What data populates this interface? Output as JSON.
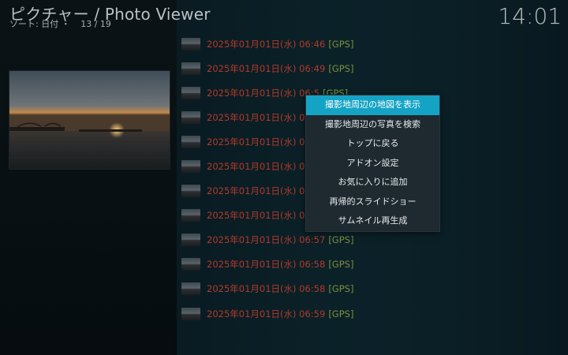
{
  "header": {
    "title": "ピクチャー / Photo Viewer",
    "sort_label": "ソート: 日付 ・",
    "count": "13 / 19"
  },
  "clock": "14:01",
  "list": {
    "items": [
      {
        "date": "2025年01月01日(水) 06:46",
        "gps": "[GPS]"
      },
      {
        "date": "2025年01月01日(水) 06:49",
        "gps": "[GPS]"
      },
      {
        "date": "2025年01月01日(水) 06:5",
        "gps": "[GPS]"
      },
      {
        "date": "2025年01月01日(水) 06:5",
        "gps": ""
      },
      {
        "date": "2025年01月01日(水) 06:5",
        "gps": ""
      },
      {
        "date": "2025年01月01日(水) 06:5",
        "gps": ""
      },
      {
        "date": "2025年01月01日(水) 06:5",
        "gps": ""
      },
      {
        "date": "2025年01月01日(水) 06:5",
        "gps": ""
      },
      {
        "date": "2025年01月01日(水) 06:57",
        "gps": "[GPS]"
      },
      {
        "date": "2025年01月01日(水) 06:58",
        "gps": "[GPS]"
      },
      {
        "date": "2025年01月01日(水) 06:58",
        "gps": "[GPS]"
      },
      {
        "date": "2025年01月01日(水) 06:59",
        "gps": "[GPS]"
      }
    ]
  },
  "context_menu": {
    "items": [
      "撮影地周辺の地図を表示",
      "撮影地周辺の写真を検索",
      "トップに戻る",
      "アドオン設定",
      "お気に入りに追加",
      "再帰的スライドショー",
      "サムネイル再生成"
    ],
    "active_index": 0
  },
  "colors": {
    "accent": "#14a3c4",
    "date_text": "#b23a2a",
    "gps_text": "#7d8f3c"
  }
}
